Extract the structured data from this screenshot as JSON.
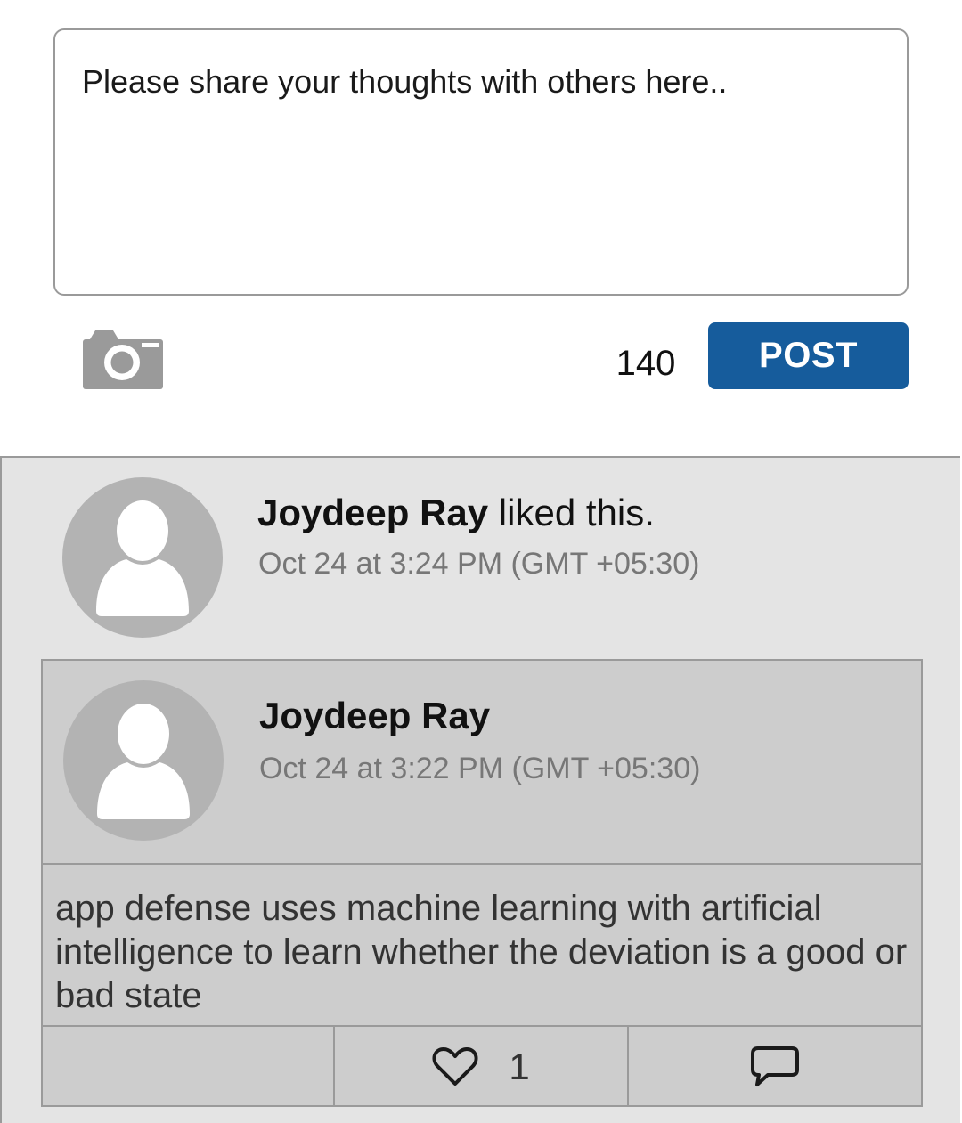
{
  "composer": {
    "placeholder": "Please share your thoughts with others here..",
    "char_count": "140",
    "post_label": "POST",
    "camera_icon": "camera-icon"
  },
  "activity": {
    "user_name": "Joydeep Ray",
    "action_text": " liked this.",
    "timestamp": "Oct 24 at  3:24 PM (GMT +05:30)"
  },
  "post": {
    "author": "Joydeep Ray",
    "timestamp": "Oct 24 at  3:22 PM (GMT +05:30)",
    "body": "app defense uses machine learning with artificial intelligence to learn whether the deviation is a good or bad state",
    "like_count": "1",
    "icons": [
      "heart-icon",
      "comment-icon"
    ]
  },
  "colors": {
    "accent": "#165c9c",
    "feed_bg": "#e4e4e4",
    "card_bg": "#cdcdcd",
    "avatar": "#b3b3b3"
  }
}
